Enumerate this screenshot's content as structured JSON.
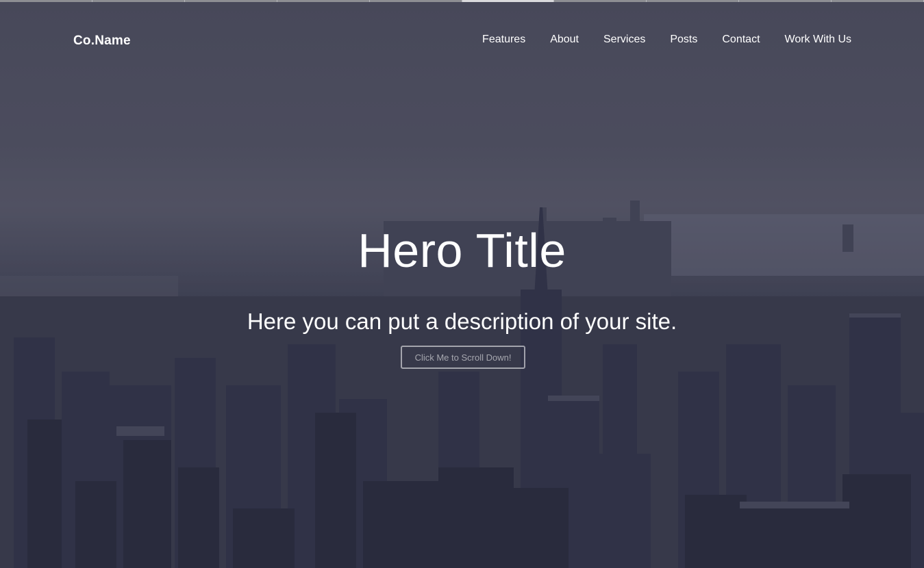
{
  "brand": {
    "name": "Co.Name"
  },
  "nav": {
    "items": [
      {
        "label": "Features"
      },
      {
        "label": "About"
      },
      {
        "label": "Services"
      },
      {
        "label": "Posts"
      },
      {
        "label": "Contact"
      },
      {
        "label": "Work With Us"
      }
    ]
  },
  "hero": {
    "title": "Hero Title",
    "description": "Here you can put a description of your site.",
    "button_label": "Click Me to Scroll Down!"
  },
  "colors": {
    "text": "#ffffff",
    "overlay": "#3d3f4c"
  }
}
